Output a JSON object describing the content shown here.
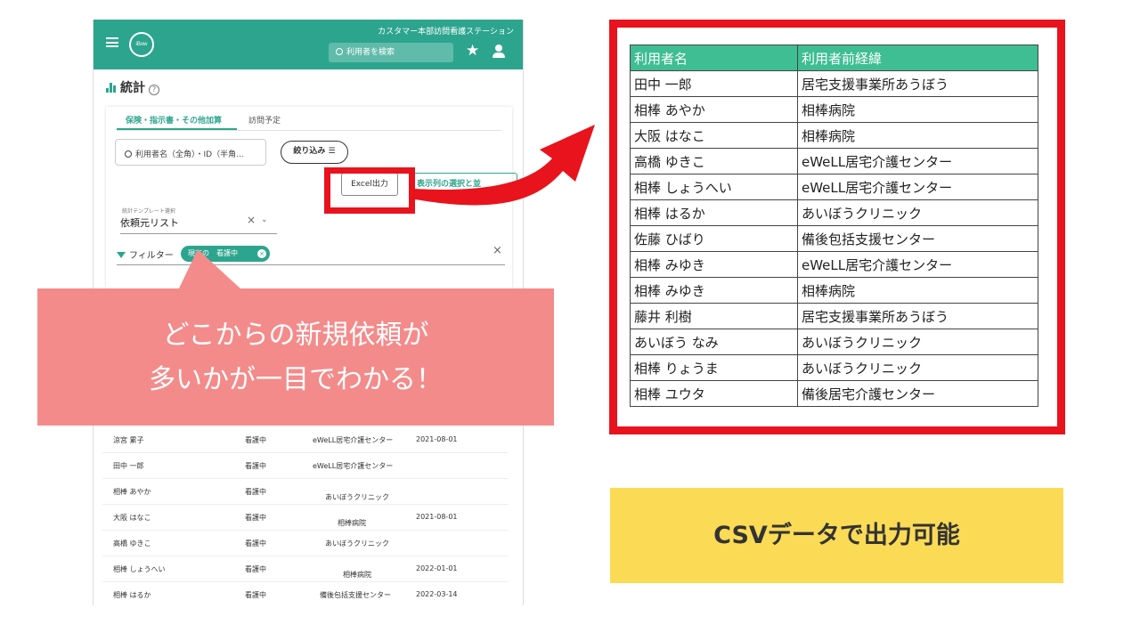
{
  "app": {
    "logo_text": "iBow",
    "station_name": "カスタマー本部訪問看護ステーション",
    "search_placeholder": "利用者を検索",
    "page_title": "統計",
    "tabs": [
      {
        "label": "保険・指示書・その他加算"
      },
      {
        "label": "訪問予定"
      }
    ],
    "name_search_placeholder": "利用者名（全角）・ID（半角...",
    "filter_button": "絞り込み",
    "excel_button": "Excel出力",
    "columns_button": "表示列の選択と並",
    "template_label": "統計テンプレート選択",
    "template_value": "依頼元リスト",
    "filter_label": "フィルター",
    "filter_chip": "現在の　看護中",
    "rows": [
      {
        "name": "涼宮 累子",
        "status": "看護中",
        "source": "eWeLL居宅介護センター",
        "date": "2021-08-01"
      },
      {
        "name": "田中 一郎",
        "status": "看護中",
        "source": "eWeLL居宅介護センター",
        "date": ""
      },
      {
        "name": "相棒 あやか",
        "status": "看護中",
        "source": "あいぼうクリニック",
        "date": ""
      },
      {
        "name": "大阪 はなこ",
        "status": "看護中",
        "source": "相棒病院",
        "date": "2021-08-01"
      },
      {
        "name": "高橋 ゆきこ",
        "status": "看護中",
        "source": "あいぼうクリニック",
        "date": ""
      },
      {
        "name": "相棒 しょうへい",
        "status": "看護中",
        "source": "相棒病院",
        "date": "2022-01-01"
      },
      {
        "name": "相棒 はるか",
        "status": "看護中",
        "source": "備後包括支援センター",
        "date": "2022-03-14"
      }
    ]
  },
  "callout": {
    "line1": "どこからの新規依頼が",
    "line2": "多いかが一目でわかる！"
  },
  "sheet": {
    "headers": [
      "利用者名",
      "利用者前経緯"
    ],
    "rows": [
      [
        "田中 一郎",
        "居宅支援事業所あうぼう"
      ],
      [
        "相棒 あやか",
        "相棒病院"
      ],
      [
        "大阪 はなこ",
        "相棒病院"
      ],
      [
        "高橋 ゆきこ",
        "eWeLL居宅介護センター"
      ],
      [
        "相棒 しょうへい",
        "eWeLL居宅介護センター"
      ],
      [
        "相棒 はるか",
        "あいぼうクリニック"
      ],
      [
        "佐藤 ひばり",
        "備後包括支援センター"
      ],
      [
        "相棒 みゆき",
        "eWeLL居宅介護センター"
      ],
      [
        "相棒 みゆき",
        "相棒病院"
      ],
      [
        "藤井 利樹",
        "居宅支援事業所あうぼう"
      ],
      [
        "あいぼう なみ",
        "あいぼうクリニック"
      ],
      [
        "相棒 りょうま",
        "あいぼうクリニック"
      ],
      [
        "相棒 ユウタ",
        "備後居宅介護センター"
      ]
    ]
  },
  "banner": {
    "text": "CSVデータで出力可能"
  },
  "colors": {
    "brand_green": "#2da58e",
    "highlight_red": "#e8131c",
    "callout_pink": "#f48b8b",
    "banner_yellow": "#fbdb55",
    "sheet_header": "#3ebe92"
  }
}
